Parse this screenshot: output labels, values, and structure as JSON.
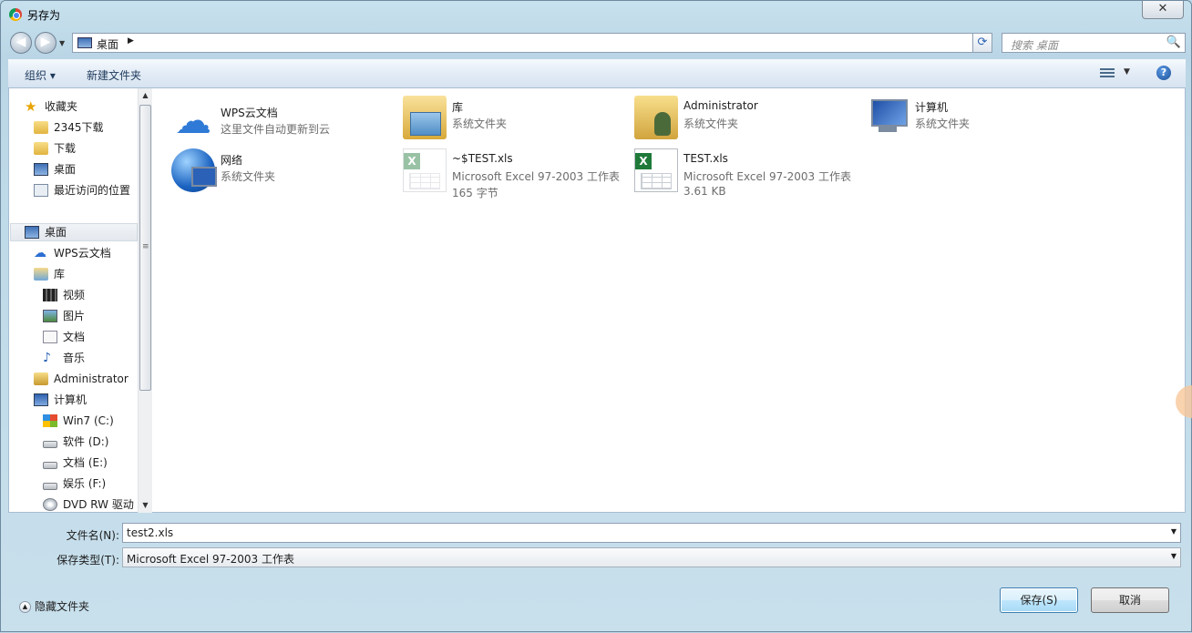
{
  "window": {
    "title": "另存为",
    "close_label": "✕"
  },
  "nav": {
    "back": "◀",
    "forward": "▶",
    "dropdown": "▼"
  },
  "address": {
    "location": "桌面",
    "separator": "▶",
    "dropdown": "▼",
    "refresh": "⟳"
  },
  "search": {
    "placeholder": "搜索 桌面",
    "icon": "🔍"
  },
  "toolbar": {
    "organize": "组织 ▾",
    "new_folder": "新建文件夹",
    "view_dropdown": "▼",
    "help": "?"
  },
  "nav_pane": {
    "items": [
      {
        "label": "收藏夹",
        "icon": "star-icon"
      },
      {
        "label": "2345下载",
        "icon": "folder-icon"
      },
      {
        "label": "下载",
        "icon": "downloads-folder-icon"
      },
      {
        "label": "桌面",
        "icon": "desktop-icon"
      },
      {
        "label": "最近访问的位置",
        "icon": "recent-places-icon"
      },
      {
        "label": "桌面",
        "icon": "desktop-icon"
      },
      {
        "label": "WPS云文档",
        "icon": "cloud-icon"
      },
      {
        "label": "库",
        "icon": "library-icon"
      },
      {
        "label": "视频",
        "icon": "video-icon"
      },
      {
        "label": "图片",
        "icon": "pictures-icon"
      },
      {
        "label": "文档",
        "icon": "documents-icon"
      },
      {
        "label": "音乐",
        "icon": "music-icon"
      },
      {
        "label": "Administrator",
        "icon": "user-folder-icon"
      },
      {
        "label": "计算机",
        "icon": "computer-icon"
      },
      {
        "label": "Win7 (C:)",
        "icon": "windows-drive-icon"
      },
      {
        "label": "软件 (D:)",
        "icon": "drive-icon"
      },
      {
        "label": "文档 (E:)",
        "icon": "drive-icon"
      },
      {
        "label": "娱乐 (F:)",
        "icon": "drive-icon"
      },
      {
        "label": "DVD RW 驱动",
        "icon": "dvd-drive-icon"
      }
    ],
    "scroll_up": "▲",
    "scroll_down": "▼",
    "grip": "≡"
  },
  "files": [
    {
      "name": "WPS云文档",
      "line1": "这里文件自动更新到云",
      "line2": "",
      "icon": "cloud-icon"
    },
    {
      "name": "库",
      "line1": "系统文件夹",
      "line2": "",
      "icon": "library-icon"
    },
    {
      "name": "Administrator",
      "line1": "系统文件夹",
      "line2": "",
      "icon": "user-folder-icon"
    },
    {
      "name": "计算机",
      "line1": "系统文件夹",
      "line2": "",
      "icon": "computer-icon"
    },
    {
      "name": "网络",
      "line1": "系统文件夹",
      "line2": "",
      "icon": "network-icon"
    },
    {
      "name": "~$TEST.xls",
      "line1": "Microsoft Excel 97-2003 工作表",
      "line2": "165 字节",
      "icon": "excel-file-icon"
    },
    {
      "name": "TEST.xls",
      "line1": "Microsoft Excel 97-2003 工作表",
      "line2": "3.61 KB",
      "icon": "excel-file-icon"
    }
  ],
  "form": {
    "filename_label": "文件名(N):",
    "filename_value": "test2.xls",
    "filetype_label": "保存类型(T):",
    "filetype_value": "Microsoft Excel 97-2003 工作表",
    "dropdown": "▼",
    "hide_folders": "隐藏文件夹",
    "hide_folders_icon": "▲",
    "save": "保存(S)",
    "cancel": "取消"
  }
}
